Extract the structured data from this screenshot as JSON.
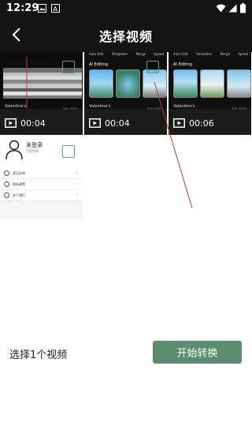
{
  "status_bar": {
    "time": "12:29",
    "icons": [
      "image-icon",
      "a-box-icon",
      "wifi-icon",
      "signal-icon",
      "battery-icon"
    ]
  },
  "navbar": {
    "back_icon": "chevron-left-icon",
    "title": "选择视频"
  },
  "videos": [
    {
      "duration": "00:04",
      "caption": "Valentine's",
      "see_more": "See more",
      "selected": false
    },
    {
      "duration": "00:04",
      "caption": "Valentine's",
      "see_more": "See more",
      "ai_label": "AI Editing",
      "tabs": [
        "Auto Edit",
        "Templates",
        "Merge",
        "Speed"
      ],
      "selected": false
    },
    {
      "duration": "00:06",
      "caption": "Valentine's",
      "see_more": "See more",
      "ai_label": "AI Editing",
      "tabs": [
        "Auto Edit",
        "Templates",
        "Merge",
        "Speed"
      ],
      "selected": false
    },
    {
      "login_title": "未登录",
      "login_sub": "立即登录",
      "menu": [
        "意见反馈",
        "隐私政策",
        "关于我们"
      ],
      "selected": false
    }
  ],
  "footer": {
    "selection_label": "选择1个视频",
    "start_button": "开始转换"
  },
  "colors": {
    "accent": "#5a8c6f",
    "checkbox_border": "#5f9c80",
    "bars": "#141414",
    "annotation_line": "#c0392b"
  }
}
